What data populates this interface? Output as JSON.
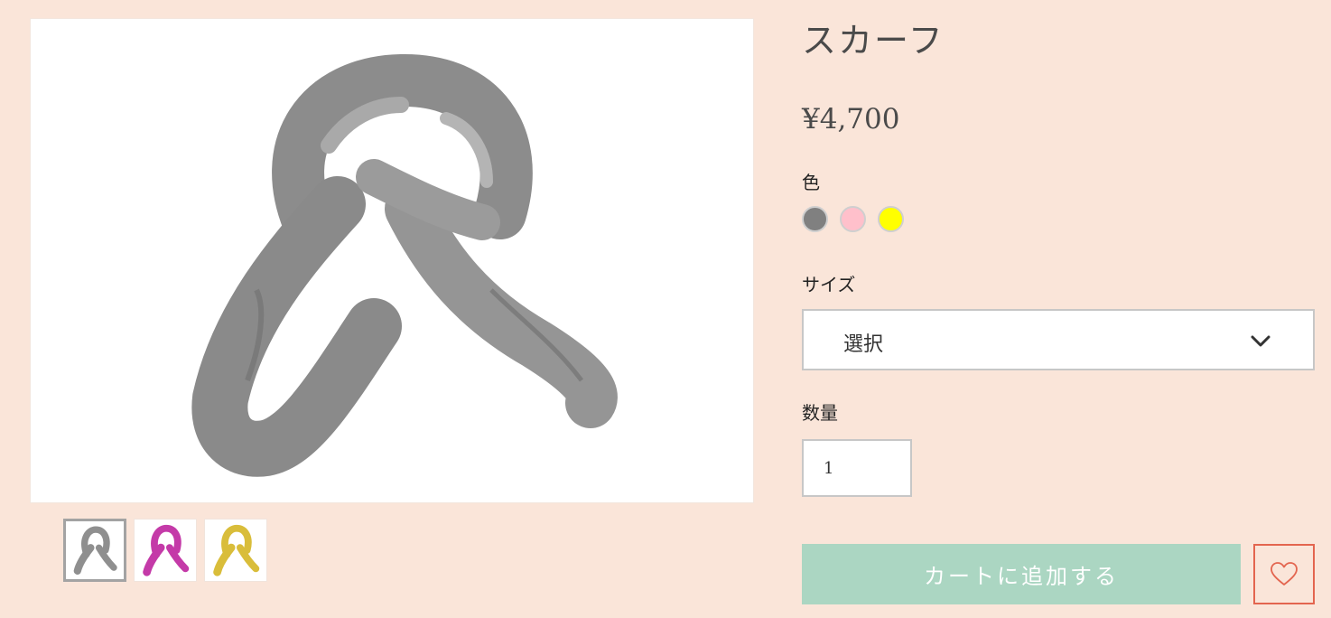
{
  "product": {
    "title": "スカーフ",
    "price": "¥4,700",
    "main_image_icon": "gray-scarf-image"
  },
  "thumbnails": [
    {
      "icon": "gray-scarf-thumbnail",
      "color": "#8f8f8f",
      "selected": true
    },
    {
      "icon": "magenta-scarf-thumbnail",
      "color": "#c43aa8",
      "selected": false
    },
    {
      "icon": "yellow-scarf-thumbnail",
      "color": "#d9bd3a",
      "selected": false
    }
  ],
  "options": {
    "color_label": "色",
    "colors": [
      {
        "name": "gray",
        "hex": "#808080"
      },
      {
        "name": "pink",
        "hex": "#ffc0cb"
      },
      {
        "name": "yellow",
        "hex": "#ffff00"
      }
    ],
    "size_label": "サイズ",
    "size_selected": "選択",
    "size_icon": "chevron-down-icon",
    "quantity_label": "数量",
    "quantity_value": "1"
  },
  "actions": {
    "add_to_cart_label": "カートに追加する",
    "add_to_cart_color": "#abd6c2",
    "wishlist_icon": "heart-icon",
    "wishlist_color": "#e3654f"
  }
}
